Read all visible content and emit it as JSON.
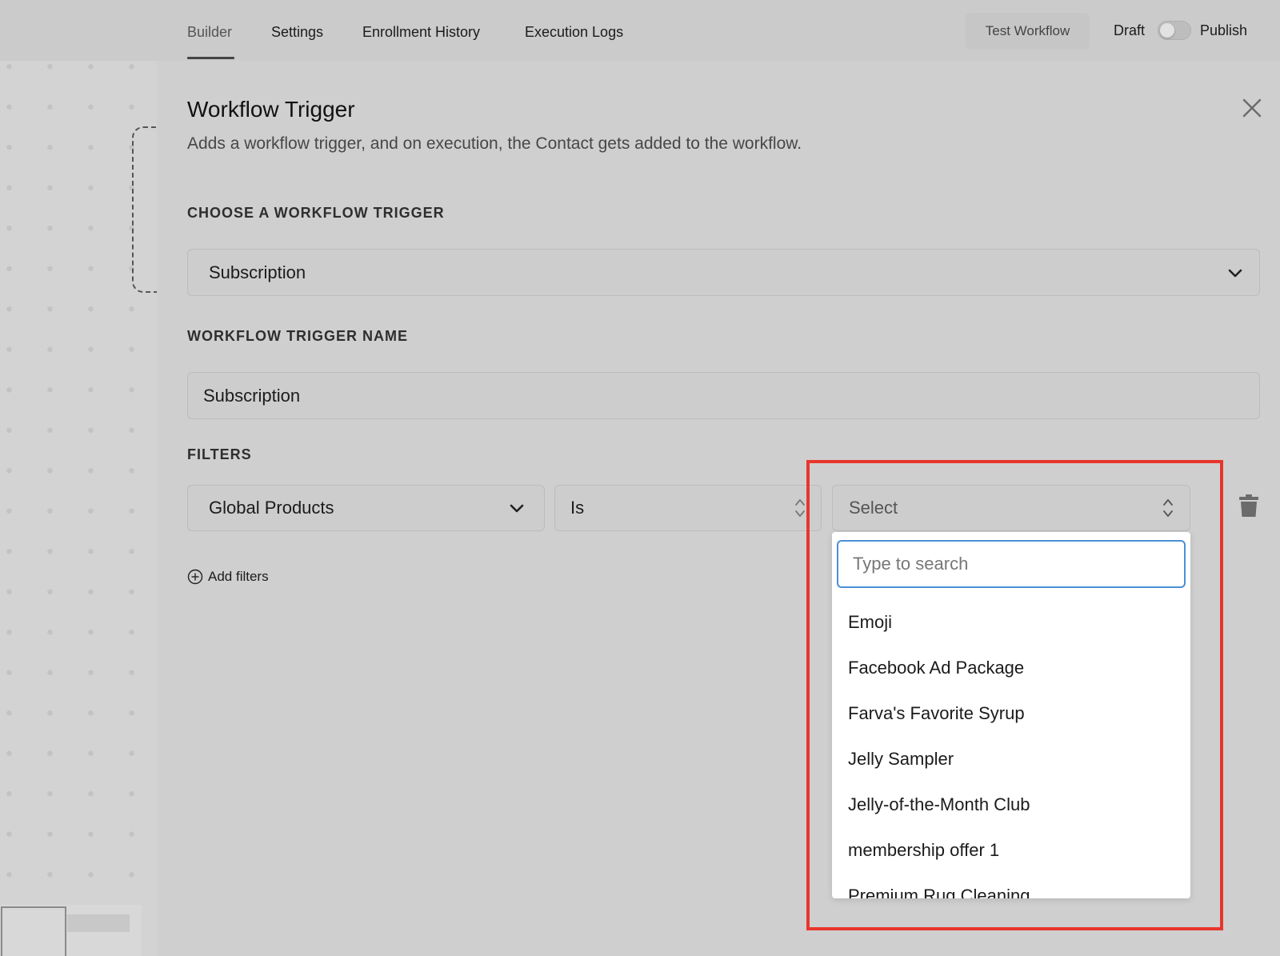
{
  "topbar": {
    "tabs": [
      "Builder",
      "Settings",
      "Enrollment History",
      "Execution Logs"
    ],
    "test_workflow": "Test Workflow",
    "draft": "Draft",
    "publish": "Publish"
  },
  "panel": {
    "title": "Workflow Trigger",
    "subtitle": "Adds a workflow trigger, and on execution, the Contact gets added to the workflow.",
    "choose_label": "CHOOSE A WORKFLOW TRIGGER",
    "trigger_value": "Subscription",
    "name_label": "WORKFLOW TRIGGER NAME",
    "name_value": "Subscription",
    "filters_label": "FILTERS",
    "filter_field": "Global Products",
    "filter_operator": "Is",
    "filter_value_placeholder": "Select",
    "add_filters": "Add filters"
  },
  "dropdown": {
    "search_placeholder": "Type to search",
    "options": [
      "Emoji",
      "Facebook Ad Package",
      "Farva's Favorite Syrup",
      "Jelly Sampler",
      "Jelly-of-the-Month Club",
      "membership offer 1",
      "Premium Rug Cleaning"
    ]
  },
  "colors": {
    "highlight": "#e8362c",
    "focus": "#4a90d9"
  }
}
